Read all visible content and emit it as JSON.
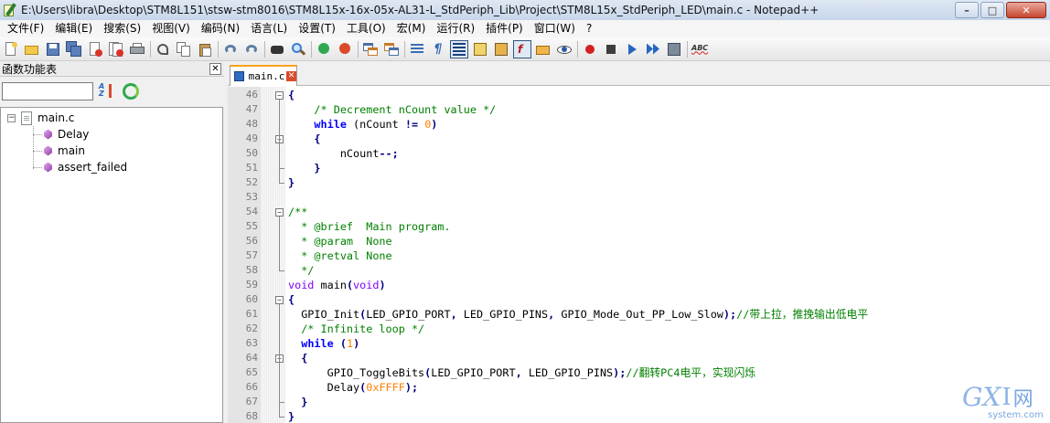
{
  "window": {
    "title": "E:\\Users\\libra\\Desktop\\STM8L151\\stsw-stm8016\\STM8L15x-16x-05x-AL31-L_StdPeriph_Lib\\Project\\STM8L15x_StdPeriph_LED\\main.c - Notepad++",
    "minimize_glyph": "–",
    "maximize_glyph": "□",
    "close_glyph": "✕"
  },
  "menu": [
    "文件(F)",
    "编辑(E)",
    "搜索(S)",
    "视图(V)",
    "编码(N)",
    "语言(L)",
    "设置(T)",
    "工具(O)",
    "宏(M)",
    "运行(R)",
    "插件(P)",
    "窗口(W)",
    "?"
  ],
  "toolbar": {
    "icons": [
      "new-file-icon",
      "open-file-icon",
      "save-icon",
      "save-all-icon",
      "close-icon",
      "close-all-icon",
      "print-icon",
      "cut-icon",
      "copy-icon",
      "paste-icon",
      "undo-icon",
      "redo-icon",
      "find-icon",
      "replace-icon",
      "zoom-in-icon",
      "zoom-out-icon",
      "sync-vertical-icon",
      "sync-horizontal-icon",
      "word-wrap-icon",
      "show-all-chars-icon",
      "indent-guide-icon",
      "document-map-icon",
      "function-list-icon",
      "folder-workspace-icon",
      "monitor-icon",
      "record-macro-icon",
      "stop-macro-icon",
      "play-macro-icon",
      "run-macro-multiple-icon",
      "save-macro-icon",
      "spell-check-icon"
    ],
    "pilcrow": "¶",
    "abc": "ABC",
    "fx": "f"
  },
  "function_panel": {
    "title": "函数功能表",
    "close": "✕",
    "search_value": "",
    "tree": {
      "file": "main.c",
      "collapse_glyph": "−",
      "functions": [
        "Delay",
        "main",
        "assert_failed"
      ]
    }
  },
  "editor": {
    "tab": {
      "label": "main.c",
      "close": "✕"
    },
    "fold_open": "−",
    "lines": [
      {
        "n": "46",
        "fold": "open",
        "tokens": [
          {
            "t": "{",
            "c": "c-op"
          }
        ]
      },
      {
        "n": "47",
        "tokens": [
          {
            "t": "    /* Decrement nCount value */",
            "c": "c-comment"
          }
        ]
      },
      {
        "n": "48",
        "tokens": [
          {
            "t": "    ",
            "c": "c-plain"
          },
          {
            "t": "while",
            "c": "c-kw"
          },
          {
            "t": " (nCount ",
            "c": "c-plain"
          },
          {
            "t": "!=",
            "c": "c-op"
          },
          {
            "t": " ",
            "c": "c-plain"
          },
          {
            "t": "0",
            "c": "c-num"
          },
          {
            "t": ")",
            "c": "c-op"
          }
        ]
      },
      {
        "n": "49",
        "fold": "open",
        "tokens": [
          {
            "t": "    ",
            "c": "c-plain"
          },
          {
            "t": "{",
            "c": "c-op"
          }
        ]
      },
      {
        "n": "50",
        "tokens": [
          {
            "t": "        nCount",
            "c": "c-plain"
          },
          {
            "t": "--;",
            "c": "c-op"
          }
        ]
      },
      {
        "n": "51",
        "fold": "end",
        "tokens": [
          {
            "t": "    ",
            "c": "c-plain"
          },
          {
            "t": "}",
            "c": "c-op"
          }
        ]
      },
      {
        "n": "52",
        "fold": "end",
        "tokens": [
          {
            "t": "}",
            "c": "c-op"
          }
        ]
      },
      {
        "n": "53",
        "tokens": []
      },
      {
        "n": "54",
        "fold": "open",
        "tokens": [
          {
            "t": "/**",
            "c": "c-comment"
          }
        ]
      },
      {
        "n": "55",
        "tokens": [
          {
            "t": "  * @brief  Main program.",
            "c": "c-comment"
          }
        ]
      },
      {
        "n": "56",
        "tokens": [
          {
            "t": "  * @param  None",
            "c": "c-comment"
          }
        ]
      },
      {
        "n": "57",
        "tokens": [
          {
            "t": "  * @retval None",
            "c": "c-comment"
          }
        ]
      },
      {
        "n": "58",
        "fold": "end",
        "tokens": [
          {
            "t": "  */",
            "c": "c-comment"
          }
        ]
      },
      {
        "n": "59",
        "tokens": [
          {
            "t": "void",
            "c": "c-type"
          },
          {
            "t": " main",
            "c": "c-plain"
          },
          {
            "t": "(",
            "c": "c-op"
          },
          {
            "t": "void",
            "c": "c-type"
          },
          {
            "t": ")",
            "c": "c-op"
          }
        ]
      },
      {
        "n": "60",
        "fold": "open",
        "tokens": [
          {
            "t": "{",
            "c": "c-op"
          }
        ]
      },
      {
        "n": "61",
        "tokens": [
          {
            "t": "  GPIO_Init",
            "c": "c-plain"
          },
          {
            "t": "(",
            "c": "c-op"
          },
          {
            "t": "LED_GPIO_PORT",
            "c": "c-plain"
          },
          {
            "t": ",",
            "c": "c-op"
          },
          {
            "t": " LED_GPIO_PINS",
            "c": "c-plain"
          },
          {
            "t": ",",
            "c": "c-op"
          },
          {
            "t": " GPIO_Mode_Out_PP_Low_Slow",
            "c": "c-plain"
          },
          {
            "t": ");",
            "c": "c-op"
          },
          {
            "t": "//带上拉，推挽输出低电平",
            "c": "c-comment"
          }
        ]
      },
      {
        "n": "62",
        "tokens": [
          {
            "t": "  /* Infinite loop */",
            "c": "c-comment"
          }
        ]
      },
      {
        "n": "63",
        "tokens": [
          {
            "t": "  ",
            "c": "c-plain"
          },
          {
            "t": "while",
            "c": "c-kw"
          },
          {
            "t": " ",
            "c": "c-plain"
          },
          {
            "t": "(",
            "c": "c-op"
          },
          {
            "t": "1",
            "c": "c-num"
          },
          {
            "t": ")",
            "c": "c-op"
          }
        ]
      },
      {
        "n": "64",
        "fold": "open",
        "tokens": [
          {
            "t": "  ",
            "c": "c-plain"
          },
          {
            "t": "{",
            "c": "c-op"
          }
        ]
      },
      {
        "n": "65",
        "tokens": [
          {
            "t": "      GPIO_ToggleBits",
            "c": "c-plain"
          },
          {
            "t": "(",
            "c": "c-op"
          },
          {
            "t": "LED_GPIO_PORT",
            "c": "c-plain"
          },
          {
            "t": ",",
            "c": "c-op"
          },
          {
            "t": " LED_GPIO_PINS",
            "c": "c-plain"
          },
          {
            "t": ");",
            "c": "c-op"
          },
          {
            "t": "//翻转PC4电平，实现闪烁",
            "c": "c-comment"
          }
        ]
      },
      {
        "n": "66",
        "tokens": [
          {
            "t": "      Delay",
            "c": "c-plain"
          },
          {
            "t": "(",
            "c": "c-op"
          },
          {
            "t": "0xFFFF",
            "c": "c-num"
          },
          {
            "t": ");",
            "c": "c-op"
          }
        ]
      },
      {
        "n": "67",
        "fold": "end",
        "tokens": [
          {
            "t": "  ",
            "c": "c-plain"
          },
          {
            "t": "}",
            "c": "c-op"
          }
        ]
      },
      {
        "n": "68",
        "fold": "end",
        "tokens": [
          {
            "t": "}",
            "c": "c-op"
          }
        ]
      }
    ]
  },
  "watermark": {
    "gx": "GX",
    "i": "I",
    "net": "网",
    "domain": "system.com"
  }
}
